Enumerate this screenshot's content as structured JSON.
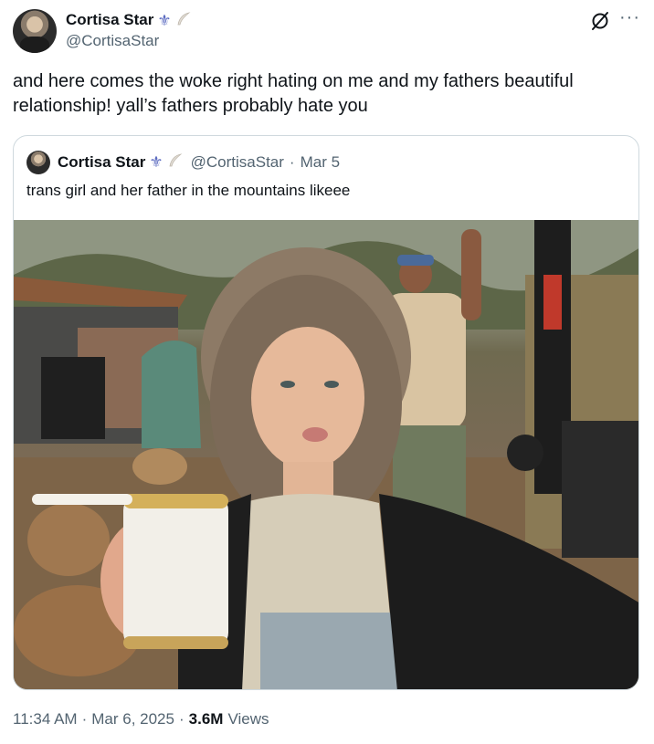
{
  "author": {
    "display_name": "Cortisa Star",
    "handle": "@CortisaStar",
    "badge_fleur": "⚜️",
    "badge_feather": "🪶"
  },
  "tweet": {
    "text": "and here comes the woke right hating on me and my fathers beautiful relationship! yall’s fathers probably hate you"
  },
  "quote": {
    "display_name": "Cortisa Star",
    "handle": "@CortisaStar",
    "separator": "·",
    "date": "Mar 5",
    "text": "trans girl and her father in the mountains likeee"
  },
  "footer": {
    "time": "11:34 AM",
    "separator1": "·",
    "date": "Mar 6, 2025",
    "separator2": "·",
    "views_count": "3.6M",
    "views_label": "Views"
  },
  "icons": {
    "grok": "grok-icon",
    "more": "more-icon"
  },
  "colors": {
    "text": "#0f1419",
    "secondary": "#536471",
    "border": "#cfd9de"
  }
}
